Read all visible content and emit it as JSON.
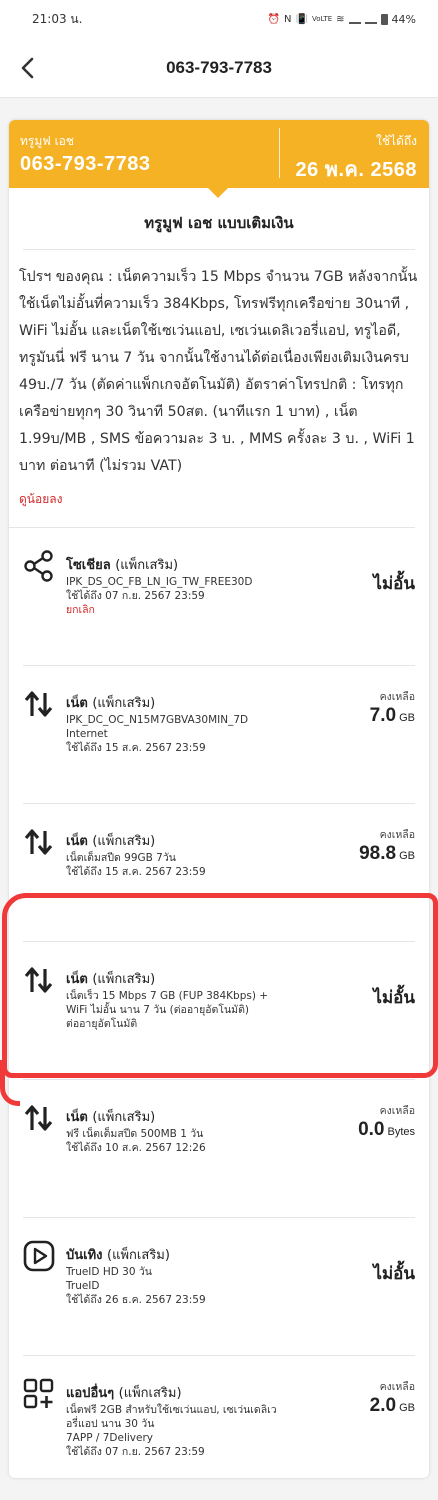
{
  "status_bar": {
    "time": "21:03 น.",
    "battery": "44%",
    "network": "VoLTE"
  },
  "app_bar": {
    "title": "063-793-7783",
    "back_icon": "chevron-left-icon"
  },
  "summary": {
    "plan_label": "ทรูมูฟ เอช",
    "number": "063-793-7783",
    "valid_label": "ใช้ได้ถึง",
    "valid_until": "26 พ.ค. 2568",
    "accent_color": "#f5b225"
  },
  "plan": {
    "name": "ทรูมูฟ เอช แบบเติมเงิน",
    "promo_text": "โปรฯ ของคุณ : เน็ตความเร็ว 15 Mbps จำนวน 7GB หลังจากนั้นใช้เน็ตไม่อั้นที่ความเร็ว 384Kbps, โทรฟรีทุกเครือข่าย 30นาที , WiFi ไม่อั้น และเน็ตใช้เซเว่นแอป, เซเว่นเดลิเวอรี่แอป, ทรูไอดี, ทรูมันนี่ ฟรี นาน 7 วัน จากนั้นใช้งานได้ต่อเนื่องเพียงเติมเงินครบ 49บ./7 วัน (ตัดค่าแพ็กเกจอัตโนมัติ) อัตราค่าโทรปกติ : โทรทุกเครือข่ายทุกๆ 30 วินาที 50สต. (นาทีแรก 1 บาท) , เน็ต 1.99บ/MB , SMS ข้อความละ 3 บ. , MMS ครั้งละ 3 บ. , WiFi 1 บาท ต่อนาที (ไม่รวม VAT)",
    "see_less": "ดูน้อยลง"
  },
  "packages": [
    {
      "icon": "share-icon",
      "title": "โซเชียล",
      "subtitle": "(แพ็กเสริม)",
      "lines": [
        "IPK_DS_OC_FB_LN_IG_TW_FREE30D",
        "ใช้ได้ถึง 07 ก.ย. 2567 23:59"
      ],
      "cancel": "ยกเลิก",
      "unlimited": "ไม่อั้น"
    },
    {
      "icon": "data-transfer-icon",
      "title": "เน็ต",
      "subtitle": "(แพ็กเสริม)",
      "lines": [
        "IPK_DC_OC_N15M7GBVA30MIN_7D",
        "Internet",
        "ใช้ได้ถึง 15 ส.ค. 2567 23:59"
      ],
      "remain_label": "คงเหลือ",
      "remain_value": "7.0",
      "remain_unit": "GB"
    },
    {
      "icon": "data-transfer-icon",
      "title": "เน็ต",
      "subtitle": "(แพ็กเสริม)",
      "lines": [
        "เน็ตเต็มสปีด 99GB 7วัน",
        "ใช้ได้ถึง 15 ส.ค. 2567 23:59"
      ],
      "remain_label": "คงเหลือ",
      "remain_value": "98.8",
      "remain_unit": "GB"
    },
    {
      "icon": "data-transfer-icon",
      "title": "เน็ต",
      "subtitle": "(แพ็กเสริม)",
      "lines": [
        "เน็ตเร็ว 15 Mbps 7 GB (FUP 384Kbps) +",
        "WiFi ไม่อั้น นาน 7 วัน (ต่ออายุอัตโนมัติ)",
        "ต่ออายุอัตโนมัติ"
      ],
      "unlimited": "ไม่อั้น"
    },
    {
      "icon": "data-transfer-icon",
      "title": "เน็ต",
      "subtitle": "(แพ็กเสริม)",
      "lines": [
        "ฟรี เน็ตเต็มสปีด 500MB 1 วัน",
        "ใช้ได้ถึง 10 ส.ค. 2567 12:26"
      ],
      "remain_label": "คงเหลือ",
      "remain_value": "0.0",
      "remain_unit": "Bytes"
    },
    {
      "icon": "play-icon",
      "title": "บันเทิง",
      "subtitle": "(แพ็กเสริม)",
      "lines": [
        "TrueID HD 30 วัน",
        "TrueID",
        "ใช้ได้ถึง 26 ธ.ค. 2567 23:59"
      ],
      "unlimited": "ไม่อั้น"
    },
    {
      "icon": "apps-add-icon",
      "title": "แอปอื่นๆ",
      "subtitle": "(แพ็กเสริม)",
      "lines": [
        "เน็ตฟรี 2GB สำหรับใช้เซเว่นแอป, เซเว่นเดลิเว",
        "อรี่แอป นาน 30 วัน",
        "7APP / 7Delivery",
        "ใช้ได้ถึง 07 ก.ย. 2567 23:59"
      ],
      "remain_label": "คงเหลือ",
      "remain_value": "2.0",
      "remain_unit": "GB"
    }
  ],
  "annotation_color": "#f03a3a"
}
